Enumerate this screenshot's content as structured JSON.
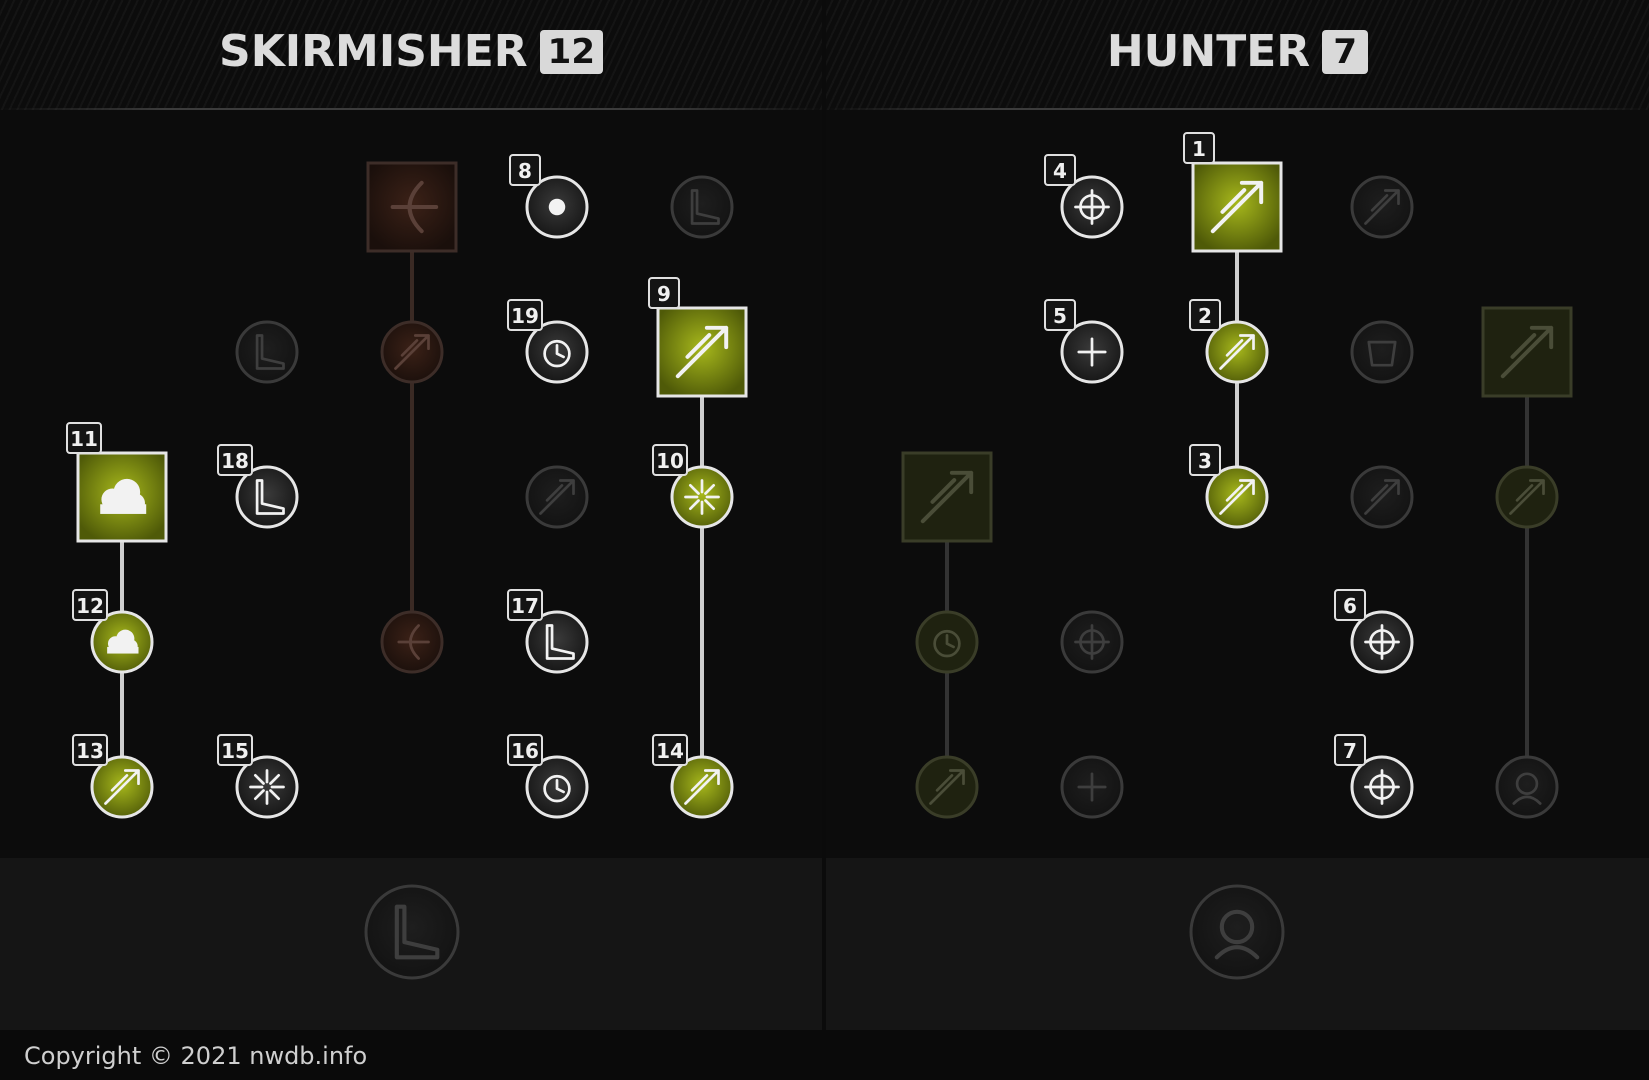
{
  "trees": [
    {
      "name": "SKIRMISHER",
      "points": "12"
    },
    {
      "name": "HUNTER",
      "points": "7"
    }
  ],
  "colors": {
    "active": "#8a9a12",
    "inactive": "#1c1c1c",
    "border_active": "#e6e6e6",
    "border_inactive": "#3a3a3a",
    "disabled_red": "#3a1c16"
  },
  "nodes": [
    {
      "id": "sk-active-archer",
      "shape": "square",
      "state": "locked-red",
      "icon": "archer-icon"
    },
    {
      "id": "sk-r1c3",
      "shape": "circle",
      "state": "active-white",
      "order": "8",
      "icon": "sidestep-icon"
    },
    {
      "id": "sk-r1c4",
      "shape": "circle",
      "state": "inactive",
      "icon": "boot-speed-icon"
    },
    {
      "id": "sk-r2c1",
      "shape": "circle",
      "state": "inactive",
      "icon": "boot-icon"
    },
    {
      "id": "sk-r2c2",
      "shape": "circle",
      "state": "locked-red",
      "icon": "dash-arrow-icon"
    },
    {
      "id": "sk-r2c3",
      "shape": "circle",
      "state": "active-white",
      "order": "19",
      "icon": "hourglass-burst-icon"
    },
    {
      "id": "sk-volley",
      "shape": "square",
      "state": "active-green",
      "order": "9",
      "icon": "rain-arrows-icon"
    },
    {
      "id": "sk-smoke",
      "shape": "square",
      "state": "active-green",
      "order": "11",
      "icon": "smoke-cloud-icon"
    },
    {
      "id": "sk-r3c1",
      "shape": "circle",
      "state": "active-white",
      "order": "18",
      "icon": "boot-wind-icon"
    },
    {
      "id": "sk-r3c3",
      "shape": "circle",
      "state": "inactive",
      "icon": "arrow-burst-icon"
    },
    {
      "id": "sk-r3c4",
      "shape": "circle",
      "state": "active-green",
      "order": "10",
      "icon": "explosion-icon"
    },
    {
      "id": "sk-r4c0",
      "shape": "circle",
      "state": "active-green",
      "order": "12",
      "icon": "smoke-cloud-icon"
    },
    {
      "id": "sk-r4c2",
      "shape": "circle",
      "state": "locked-red",
      "icon": "archer-icon"
    },
    {
      "id": "sk-r4c3",
      "shape": "circle",
      "state": "active-white",
      "order": "17",
      "icon": "boot-up-icon"
    },
    {
      "id": "sk-r5c0",
      "shape": "circle",
      "state": "active-green",
      "order": "13",
      "icon": "target-streak-icon"
    },
    {
      "id": "sk-r5c1",
      "shape": "circle",
      "state": "active-white",
      "order": "15",
      "icon": "burst-up-icon"
    },
    {
      "id": "sk-r5c3",
      "shape": "circle",
      "state": "active-white",
      "order": "16",
      "icon": "stopwatch-icon"
    },
    {
      "id": "sk-r5c4",
      "shape": "circle",
      "state": "active-green",
      "order": "14",
      "icon": "boot-dash-icon"
    },
    {
      "id": "sk-ultimate",
      "shape": "circle-large",
      "state": "inactive",
      "icon": "boot-slash-icon"
    },
    {
      "id": "hu-r1c1",
      "shape": "circle",
      "state": "active-white",
      "order": "4",
      "icon": "head-target-icon"
    },
    {
      "id": "hu-penetrating",
      "shape": "square",
      "state": "active-green",
      "order": "1",
      "icon": "piercing-arrow-icon"
    },
    {
      "id": "hu-r1c3",
      "shape": "circle",
      "state": "inactive",
      "icon": "triple-arrow-icon"
    },
    {
      "id": "hu-r2c1",
      "shape": "circle",
      "state": "active-white",
      "order": "5",
      "icon": "heal-burst-icon"
    },
    {
      "id": "hu-r2c2",
      "shape": "circle",
      "state": "active-green",
      "order": "2",
      "icon": "arrows-cross-icon"
    },
    {
      "id": "hu-r2c3",
      "shape": "circle",
      "state": "inactive",
      "icon": "armor-icon"
    },
    {
      "id": "hu-rainofarrows",
      "shape": "square",
      "state": "inactive",
      "icon": "arrows-spread-icon"
    },
    {
      "id": "hu-poison",
      "shape": "square",
      "state": "inactive",
      "icon": "double-arrow-icon"
    },
    {
      "id": "hu-r3c2",
      "shape": "circle",
      "state": "active-green",
      "order": "3",
      "icon": "arrow-up-right-icon"
    },
    {
      "id": "hu-r3c3",
      "shape": "circle",
      "state": "inactive",
      "icon": "swirl-arrow-icon"
    },
    {
      "id": "hu-r3c4",
      "shape": "circle",
      "state": "inactive",
      "icon": "arrows-down-icon"
    },
    {
      "id": "hu-r4c0",
      "shape": "circle",
      "state": "inactive",
      "icon": "hourglass-down-icon"
    },
    {
      "id": "hu-r4c1",
      "shape": "circle",
      "state": "inactive",
      "icon": "crosshair-icon"
    },
    {
      "id": "hu-r4c3",
      "shape": "circle",
      "state": "active-white",
      "order": "6",
      "icon": "eye-target-icon"
    },
    {
      "id": "hu-r5c0",
      "shape": "circle",
      "state": "inactive",
      "icon": "arrow-explosion-icon"
    },
    {
      "id": "hu-r5c1",
      "shape": "circle",
      "state": "inactive",
      "icon": "double-heal-icon"
    },
    {
      "id": "hu-r5c3",
      "shape": "circle",
      "state": "active-white",
      "order": "7",
      "icon": "target-wheel-icon"
    },
    {
      "id": "hu-r5c4",
      "shape": "circle",
      "state": "inactive",
      "icon": "skull-clock-icon"
    },
    {
      "id": "hu-ultimate",
      "shape": "circle-large",
      "state": "inactive",
      "icon": "head-burst-icon"
    }
  ],
  "footer": {
    "copyright": "Copyright © 2021 nwdb.info"
  }
}
